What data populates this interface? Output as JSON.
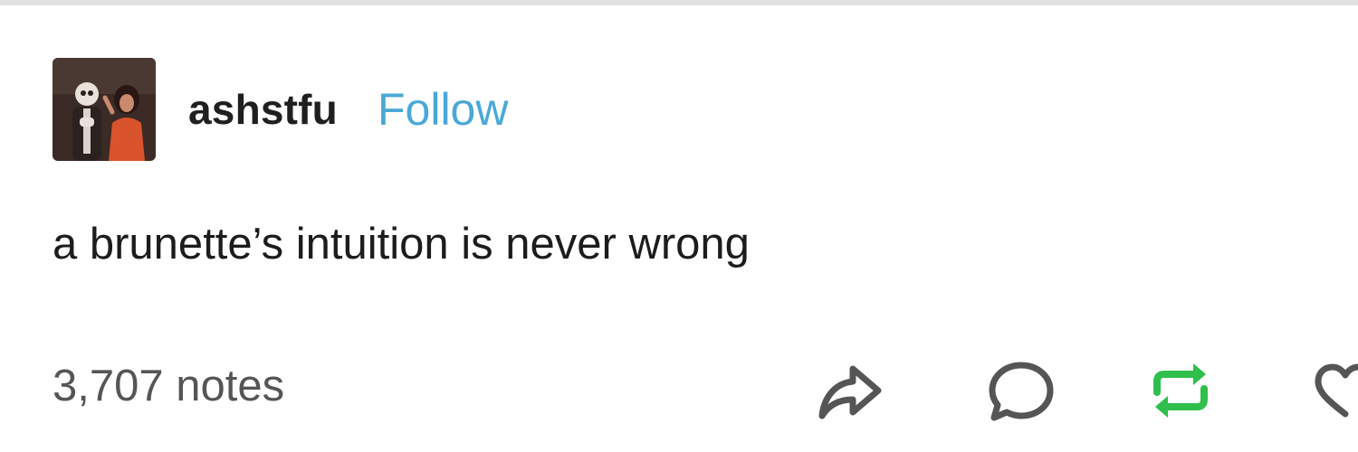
{
  "post": {
    "author": {
      "username": "ashstfu",
      "follow_label": "Follow"
    },
    "text": "a brunette’s intuition is never wrong",
    "notes_label": "3,707 notes",
    "actions": {
      "share_icon": "share-icon",
      "reply_icon": "reply-icon",
      "reblog_icon": "reblog-icon",
      "like_icon": "heart-icon"
    }
  },
  "colors": {
    "follow": "#4aa8d8",
    "reblog": "#2fbf4c",
    "icon": "#555555",
    "notes": "#555555",
    "divider": "#e3e3e3"
  }
}
